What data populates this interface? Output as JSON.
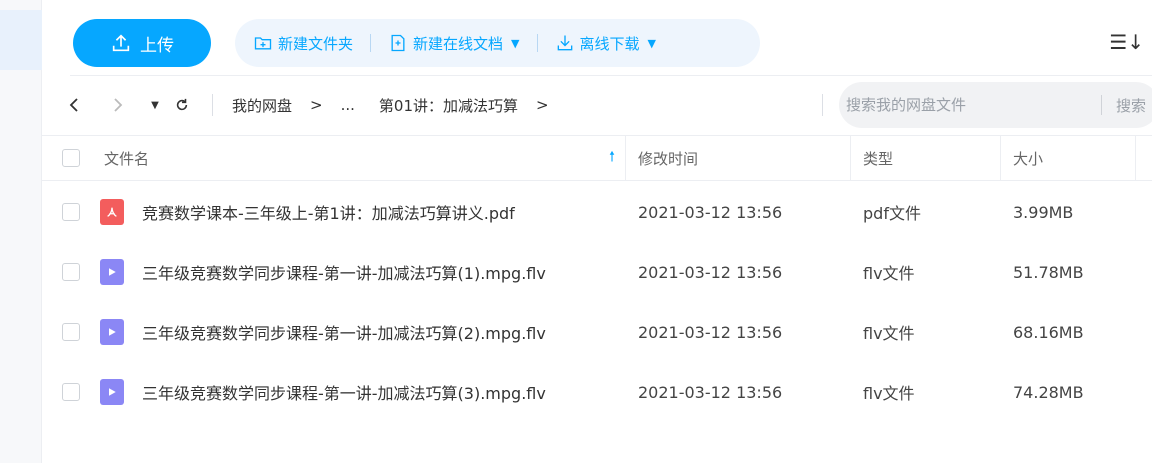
{
  "toolbar": {
    "upload_label": "上传",
    "new_folder_label": "新建文件夹",
    "new_doc_label": "新建在线文档",
    "offline_download_label": "离线下载"
  },
  "nav": {
    "breadcrumbs": [
      "我的网盘",
      "...",
      "第01讲：加减法巧算"
    ],
    "search_placeholder": "搜索我的网盘文件",
    "search_button": "搜索"
  },
  "table": {
    "headers": {
      "name": "文件名",
      "modified": "修改时间",
      "type": "类型",
      "size": "大小"
    },
    "rows": [
      {
        "icon": "pdf-file-icon",
        "name": "竞赛数学课本-三年级上-第1讲：加减法巧算讲义.pdf",
        "modified": "2021-03-12 13:56",
        "type": "pdf文件",
        "size": "3.99MB"
      },
      {
        "icon": "video-file-icon",
        "name": "三年级竞赛数学同步课程-第一讲-加减法巧算(1).mpg.flv",
        "modified": "2021-03-12 13:56",
        "type": "flv文件",
        "size": "51.78MB"
      },
      {
        "icon": "video-file-icon",
        "name": "三年级竞赛数学同步课程-第一讲-加减法巧算(2).mpg.flv",
        "modified": "2021-03-12 13:56",
        "type": "flv文件",
        "size": "68.16MB"
      },
      {
        "icon": "video-file-icon",
        "name": "三年级竞赛数学同步课程-第一讲-加减法巧算(3).mpg.flv",
        "modified": "2021-03-12 13:56",
        "type": "flv文件",
        "size": "74.28MB"
      }
    ]
  },
  "colors": {
    "accent": "#06a7ff",
    "pdf": "#f35d5d",
    "video": "#8b87f5"
  }
}
